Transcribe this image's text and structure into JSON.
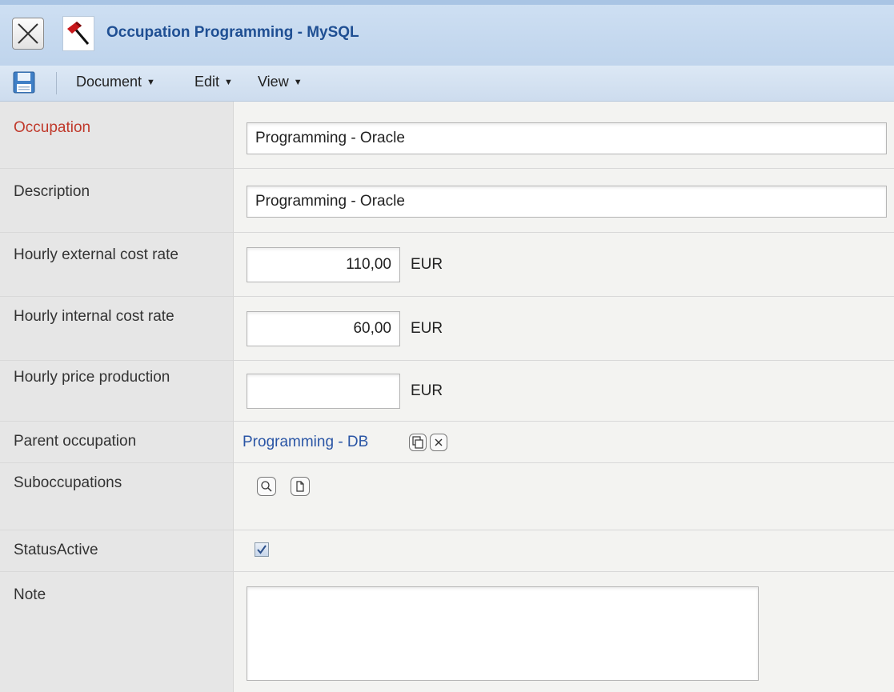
{
  "window": {
    "title": "Occupation Programming - MySQL"
  },
  "toolbar": {
    "menus": [
      "Document",
      "Edit",
      "View"
    ]
  },
  "form": {
    "occupation": {
      "label": "Occupation",
      "value": "Programming - Oracle"
    },
    "description": {
      "label": "Description",
      "value": "Programming - Oracle"
    },
    "external_rate": {
      "label": "Hourly external cost rate",
      "value": "110,00",
      "unit": "EUR"
    },
    "internal_rate": {
      "label": "Hourly internal cost rate",
      "value": "60,00",
      "unit": "EUR"
    },
    "price_production": {
      "label": "Hourly price production",
      "value": "",
      "unit": "EUR"
    },
    "parent": {
      "label": "Parent occupation",
      "value": "Programming - DB"
    },
    "suboccupations": {
      "label": "Suboccupations"
    },
    "status": {
      "label": "StatusActive",
      "checked": true
    },
    "note": {
      "label": "Note",
      "value": ""
    }
  },
  "colors": {
    "required_label": "#c0392b",
    "title": "#1f4f93",
    "link": "#2a55a5"
  }
}
